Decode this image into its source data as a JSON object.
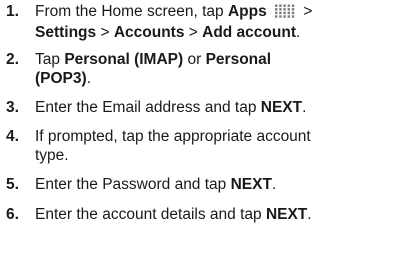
{
  "steps": [
    {
      "number": "1.",
      "parts": {
        "p1": "From the Home screen, tap ",
        "apps": "Apps",
        "sep1": " > ",
        "settings": "Settings",
        "sep2": " > ",
        "accounts": "Accounts",
        "sep3": " > ",
        "add_account": "Add account",
        "end": "."
      },
      "icon": "apps-grid-icon"
    },
    {
      "number": "2.",
      "parts": {
        "p1": "Tap ",
        "imap": "Personal (IMAP)",
        "or": " or ",
        "pop3_line1": "Personal",
        "pop3_line2": "(POP3)",
        "end": "."
      }
    },
    {
      "number": "3.",
      "parts": {
        "p1": "Enter the Email address and tap ",
        "next": "NEXT",
        "end": "."
      }
    },
    {
      "number": "4.",
      "parts": {
        "line1": "If prompted, tap the appropriate account",
        "line2": "type."
      }
    },
    {
      "number": "5.",
      "parts": {
        "p1": "Enter the Password and tap ",
        "next": "NEXT",
        "end": "."
      }
    },
    {
      "number": "6.",
      "parts": {
        "p1": "Enter the account details and tap ",
        "next": "NEXT",
        "end": "."
      }
    }
  ],
  "colors": {
    "text": "#1a1a1a",
    "icon": "#7a7a7a"
  }
}
